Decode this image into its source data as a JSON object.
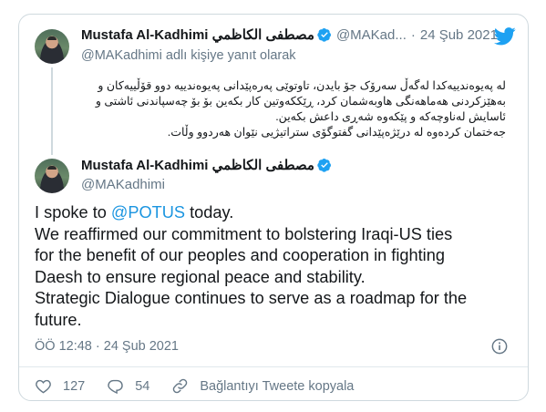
{
  "colors": {
    "accent": "#1b95e0",
    "verified": "#1da1f2",
    "muted": "#657786",
    "border": "#cfd9de"
  },
  "reply_tweet": {
    "author_name": "Mustafa Al-Kadhimi مصطفى الكاظمي",
    "handle": "@MAKad...",
    "separator": "·",
    "date": "24 Şub 2021",
    "reply_context": "@MAKadhimi adlı kişiye yanıt olarak",
    "text_lines": [
      "لە پەیوەندییەکدا لەگەڵ سەرۆک جۆ بایدن، تاوتوێی پەرەپێدانی پەیوەندییە دوو قۆڵییەکان و",
      "بەهێزکردنی هەماهەنگی هاوبەشمان کرد، ڕێککەوتین کار بکەین بۆ بۆ چەسپاندنی ئاشتی و",
      "ئاسایش لەناوچەکە و پێکەوە شەڕی داعش بکەین.",
      "جەختمان کردەوە لە درێژەپێدانی گفتوگۆی ستراتیژیی نێوان هەردوو وڵات."
    ]
  },
  "main_tweet": {
    "author_name": "Mustafa Al-Kadhimi مصطفى الكاظمي",
    "handle": "@MAKadhimi",
    "text_prefix": "I spoke to ",
    "mention": "@POTUS",
    "text_after_mention": " today.",
    "lines": [
      "We reaffirmed our commitment to bolstering Iraqi-US ties",
      "for the benefit of our peoples and cooperation in fighting",
      "Daesh to ensure regional peace and stability.",
      "Strategic Dialogue continues to serve as a roadmap for the",
      "future."
    ],
    "timestamp": "ÖÖ 12:48 · 24 Şub 2021"
  },
  "actions": {
    "likes": "127",
    "replies": "54",
    "copy_link": "Bağlantıyı Tweete kopyala"
  },
  "icons": {
    "brand": "twitter-bird-icon",
    "verified": "verified-badge-icon",
    "info": "info-icon",
    "like": "heart-icon",
    "reply": "reply-bubble-icon",
    "link": "link-icon"
  }
}
